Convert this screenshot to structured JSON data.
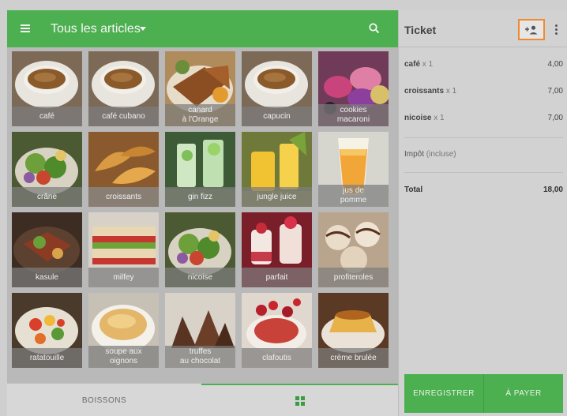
{
  "header": {
    "category_title": "Tous les articles",
    "menu_icon": "menu-icon",
    "dropdown_icon": "chevron-down-icon",
    "search_icon": "search-icon"
  },
  "products": [
    {
      "label": "café",
      "food": "coffee"
    },
    {
      "label": "café cubano",
      "food": "coffee"
    },
    {
      "label": "canard\nà l'Orange",
      "food": "duck"
    },
    {
      "label": "capucin",
      "food": "coffee"
    },
    {
      "label": "cookies\nmacaroni",
      "food": "macaron"
    },
    {
      "label": "crâne",
      "food": "salad"
    },
    {
      "label": "croissants",
      "food": "croissant"
    },
    {
      "label": "gin fizz",
      "food": "drink"
    },
    {
      "label": "jungle juice",
      "food": "juice"
    },
    {
      "label": "jus de\npomme",
      "food": "apple-juice"
    },
    {
      "label": "kasule",
      "food": "meat"
    },
    {
      "label": "milfey",
      "food": "sandwich"
    },
    {
      "label": "nicoise",
      "food": "salad"
    },
    {
      "label": "parfait",
      "food": "dessert"
    },
    {
      "label": "profiteroles",
      "food": "pastry"
    },
    {
      "label": "ratatouille",
      "food": "veg"
    },
    {
      "label": "soupe aux\noignons",
      "food": "soup"
    },
    {
      "label": "truffes\nau chocolat",
      "food": "chocolate"
    },
    {
      "label": "clafoutis",
      "food": "cherry"
    },
    {
      "label": "crème brulée",
      "food": "flan"
    }
  ],
  "bottom_tabs": {
    "boissons_label": "BOISSONS",
    "grid_icon": "grid-icon"
  },
  "ticket": {
    "title": "Ticket",
    "add_customer_icon": "add-customer-icon",
    "more_icon": "more-vertical-icon",
    "items": [
      {
        "name": "café",
        "qty": "x 1",
        "price": "4,00"
      },
      {
        "name": "croissants",
        "qty": "x 1",
        "price": "7,00"
      },
      {
        "name": "nicoise",
        "qty": "x 1",
        "price": "7,00"
      }
    ],
    "tax_label": "Impôt",
    "tax_note": "(incluse)",
    "total_label": "Total",
    "total_value": "18,00",
    "save_label": "ENREGISTRER",
    "pay_label": "À PAYER"
  },
  "colors": {
    "accent": "#4caf50",
    "highlight": "#f08a30"
  }
}
